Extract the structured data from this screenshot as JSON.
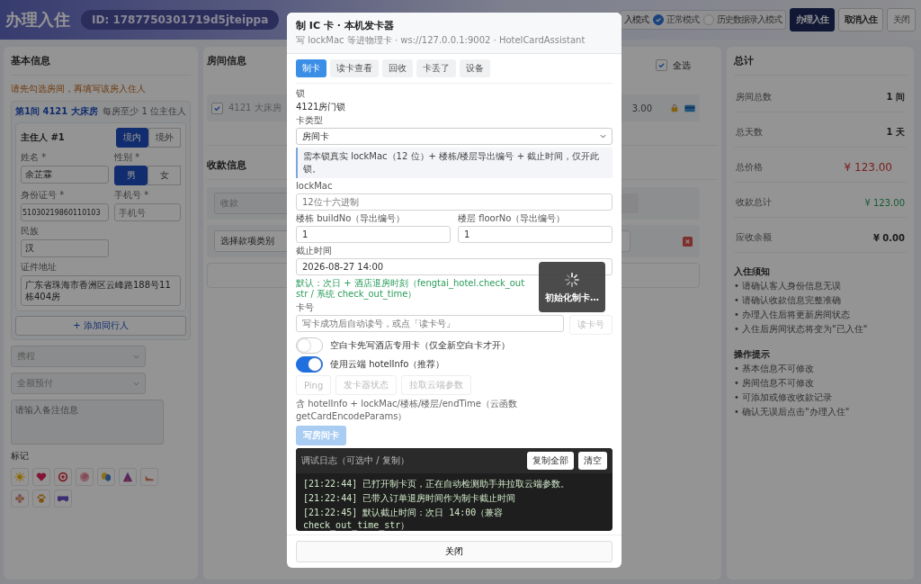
{
  "header": {
    "title": "办理入住",
    "order_id": "ID: 1787750301719d5jteippa",
    "mode_label": "入模式",
    "modes": [
      {
        "label": "正常模式",
        "selected": true
      },
      {
        "label": "历史数据录入模式",
        "selected": false
      }
    ],
    "buttons": [
      {
        "label": "办理入住",
        "kind": "primary"
      },
      {
        "label": "取消入住",
        "kind": "default"
      },
      {
        "label": "关闭",
        "kind": "plain"
      }
    ]
  },
  "basic": {
    "title": "基本信息",
    "hint": "请先勾选房间，再填写该房入住人",
    "room": {
      "title": "第1间 4121 大床房",
      "note": "每房至少 1 位主住人",
      "guest": {
        "title": "主住人 #1",
        "origin": [
          {
            "label": "境内",
            "selected": true
          },
          {
            "label": "境外",
            "selected": false
          }
        ],
        "name": {
          "label": "姓名 *",
          "value": "余芷霖"
        },
        "gender": {
          "label": "性别 *",
          "options": [
            {
              "label": "男",
              "selected": true
            },
            {
              "label": "女",
              "selected": false
            }
          ]
        },
        "id_number": {
          "label": "身份证号 *",
          "value": "51030219860110103"
        },
        "phone": {
          "label": "手机号 *",
          "placeholder": "手机号"
        },
        "ethnicity": {
          "label": "民族",
          "value": "汉"
        },
        "address": {
          "label": "证件地址",
          "value": "广东省珠海市香洲区云峰路188号11栋404房"
        }
      },
      "add_button": "+ 添加同行人"
    },
    "channel": "携程",
    "payment": "全额预付",
    "remark_placeholder": "请输入备注信息",
    "tags_label": "标记"
  },
  "rooms": {
    "title": "房间信息",
    "select_all": {
      "label": "全选",
      "checked": true
    },
    "items": [
      {
        "name": "4121 大床房",
        "checked": true,
        "price": "3.00"
      }
    ]
  },
  "payments": {
    "title": "收款信息",
    "type": "收款",
    "category_placeholder": "选择款项类别"
  },
  "summary": {
    "title": "总计",
    "rows": [
      {
        "label": "房间总数",
        "value": "1 间",
        "kind": "plain"
      },
      {
        "label": "总天数",
        "value": "1 天",
        "kind": "plain"
      },
      {
        "label": "总价格",
        "value": "¥ 123.00",
        "kind": "price"
      },
      {
        "label": "收款总计",
        "value": "¥ 123.00",
        "kind": "paid"
      },
      {
        "label": "应收余额",
        "value": "¥ 0.00",
        "kind": "plain"
      }
    ],
    "sections": [
      {
        "title": "入住须知",
        "items": [
          "• 请确认客人身份信息无误",
          "• 请确认收款信息完整准确",
          "• 办理入住后将更新房间状态",
          "• 入住后房间状态将变为\"已入住\""
        ]
      },
      {
        "title": "操作提示",
        "items": [
          "• 基本信息不可修改",
          "• 房间信息不可修改",
          "• 可添加或修改收款记录",
          "• 确认无误后点击\"办理入住\""
        ]
      }
    ]
  },
  "modal": {
    "title": "制 IC 卡 · 本机发卡器",
    "subtitle": "写 lockMac 等进物理卡 · ws://127.0.0.1:9002 · HotelCardAssistant",
    "tabs": [
      {
        "label": "制卡",
        "selected": true
      },
      {
        "label": "读卡查看",
        "selected": false
      },
      {
        "label": "回收",
        "selected": false
      },
      {
        "label": "卡丢了",
        "selected": false
      },
      {
        "label": "设备",
        "selected": false
      }
    ],
    "lock": {
      "label": "锁",
      "value": "4121房门锁"
    },
    "card_type": {
      "label": "卡类型",
      "value": "房间卡"
    },
    "notice": "需本锁真实 lockMac（12 位）+ 楼栋/楼层导出编号 + 截止时间，仅开此锁。",
    "lock_mac": {
      "label": "lockMac",
      "placeholder": "12位十六进制"
    },
    "build_no": {
      "label": "楼栋 buildNo（导出编号）",
      "value": "1"
    },
    "floor_no": {
      "label": "楼层 floorNo（导出编号）",
      "value": "1"
    },
    "end_time": {
      "label": "截止时间",
      "value": "2026-08-27 14:00"
    },
    "end_time_hint": [
      "默认：次日 + 酒店退房时刻（fengtai_hotel.check_out",
      "str / 系统 check_out_time）"
    ],
    "card_no": {
      "label": "卡号",
      "placeholder": "写卡成功后自动读号，或点「读卡号」",
      "button": "读卡号"
    },
    "switches": [
      {
        "label": "空白卡先写酒店专用卡（仅全新空白卡才开）",
        "on": false
      },
      {
        "label": "使用云端 hotelInfo（推荐）",
        "on": true
      }
    ],
    "tools": [
      {
        "label": "Ping",
        "disabled": true
      },
      {
        "label": "发卡器状态",
        "disabled": true
      },
      {
        "label": "拉取云端参数",
        "disabled": true
      }
    ],
    "note": "含 hotelInfo + lockMac/楼栋/楼层/endTime（云函数 getCardEncodeParams）",
    "write_button": {
      "label": "写房间卡",
      "disabled": true
    },
    "log": {
      "title": "调试日志（可选中 / 复制）",
      "buttons": [
        "复制全部",
        "清空"
      ],
      "lines": [
        "[21:22:44] 已打开制卡页，正在自动检测助手并拉取云端参数。",
        "[21:22:44] 已带入订单退房时间作为制卡截止时间",
        "[21:22:45] 默认截止时间：次日 14:00（兼容 check_out_time_str）"
      ]
    },
    "close": "关闭",
    "toast": "初始化制卡…"
  }
}
